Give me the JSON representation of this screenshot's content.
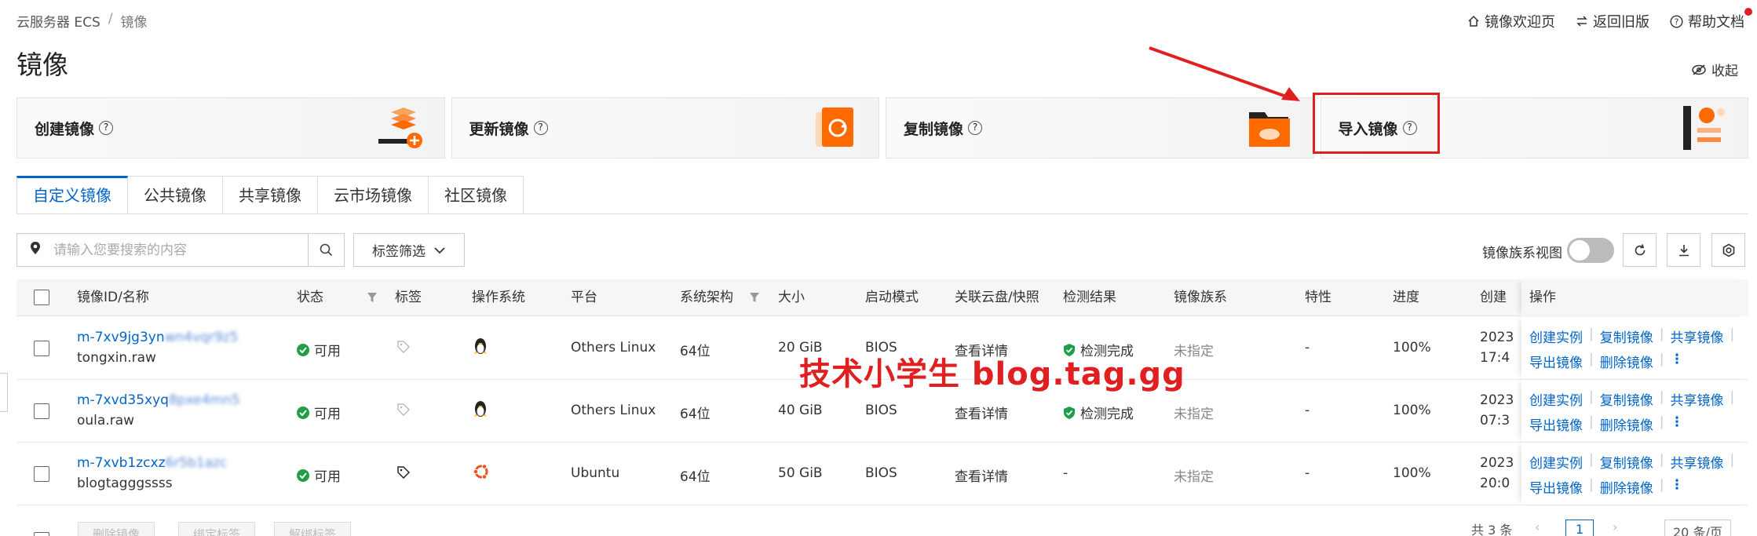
{
  "breadcrumb": {
    "root": "云服务器 ECS",
    "sep": "/",
    "current": "镜像"
  },
  "top_links": {
    "welcome": "镜像欢迎页",
    "old": "返回旧版",
    "help": "帮助文档"
  },
  "page_title": "镜像",
  "collapse_label": "收起",
  "cards": [
    {
      "label": "创建镜像",
      "icon": "create-image-icon"
    },
    {
      "label": "更新镜像",
      "icon": "update-image-icon"
    },
    {
      "label": "复制镜像",
      "icon": "copy-image-icon"
    },
    {
      "label": "导入镜像",
      "icon": "import-image-icon"
    }
  ],
  "tabs": [
    "自定义镜像",
    "公共镜像",
    "共享镜像",
    "云市场镜像",
    "社区镜像"
  ],
  "search": {
    "placeholder": "请输入您要搜索的内容"
  },
  "tag_filter": "标签筛选",
  "family_view": "镜像族系视图",
  "columns": {
    "id": "镜像ID/名称",
    "status": "状态",
    "tag": "标签",
    "os": "操作系统",
    "platform": "平台",
    "arch": "系统架构",
    "size": "大小",
    "boot": "启动模式",
    "disk": "关联云盘/快照",
    "check": "检测结果",
    "family": "镜像族系",
    "feature": "特性",
    "progress": "进度",
    "created": "创建",
    "ops": "操作"
  },
  "rows": [
    {
      "id": "m-7xv9jg3yn",
      "id_blur": "wn4vqr9z5",
      "name": "tongxin.raw",
      "status": "可用",
      "platform": "Others Linux",
      "arch": "64位",
      "size": "20 GiB",
      "boot": "BIOS",
      "disk": "查看详情",
      "check": "检测完成",
      "family": "未指定",
      "feature": "-",
      "progress": "100%",
      "created1": "2023",
      "created2": "17:4"
    },
    {
      "id": "m-7xvd35xyq",
      "id_blur": "8pxe4mn5",
      "name": "oula.raw",
      "status": "可用",
      "platform": "Others Linux",
      "arch": "64位",
      "size": "40 GiB",
      "boot": "BIOS",
      "disk": "查看详情",
      "check": "检测完成",
      "family": "未指定",
      "feature": "-",
      "progress": "100%",
      "created1": "2023",
      "created2": "07:3"
    },
    {
      "id": "m-7xvb1zcxz",
      "id_blur": "6r5b1azc",
      "name": "blogtagggssss",
      "status": "可用",
      "platform": "Ubuntu",
      "arch": "64位",
      "size": "50 GiB",
      "boot": "BIOS",
      "disk": "查看详情",
      "check": "-",
      "family": "未指定",
      "feature": "-",
      "progress": "100%",
      "created1": "2023",
      "created2": "20:0"
    }
  ],
  "ops": {
    "create": "创建实例",
    "copy": "复制镜像",
    "share": "共享镜像",
    "export": "导出镜像",
    "delete": "删除镜像"
  },
  "watermark": "技术小学生 blog.tag.gg",
  "footer": {
    "delete": "删除镜像",
    "bind": "绑定标签",
    "unbind": "解绑标签",
    "total": "共 3 条",
    "page": "1",
    "per_page": "20 条/页"
  },
  "colors": {
    "accent": "#0064c8",
    "success": "#1e9e48",
    "highlight": "#e02020"
  }
}
